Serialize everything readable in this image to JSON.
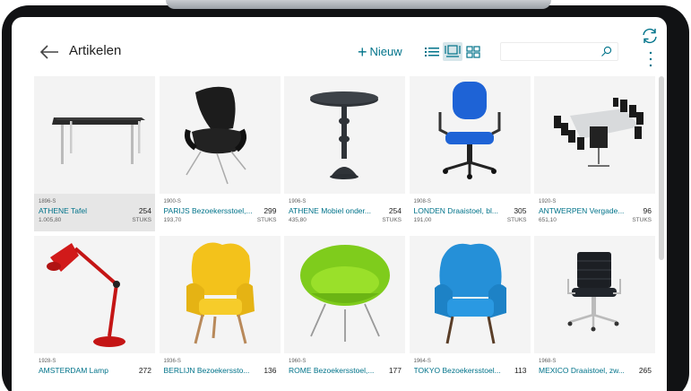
{
  "header": {
    "title": "Artikelen",
    "new_label": "Nieuw"
  },
  "items": [
    {
      "code": "1896-S",
      "name": "ATHENE Tafel",
      "qty": "254",
      "price": "1.005,80",
      "unit": "STUKS",
      "selected": true
    },
    {
      "code": "1900-S",
      "name": "PARIJS Bezoekersstoel,...",
      "qty": "299",
      "price": "193,70",
      "unit": "STUKS"
    },
    {
      "code": "1906-S",
      "name": "ATHENE Mobiel onder...",
      "qty": "254",
      "price": "435,80",
      "unit": "STUKS"
    },
    {
      "code": "1908-S",
      "name": "LONDEN Draaistoel, bl...",
      "qty": "305",
      "price": "191,00",
      "unit": "STUKS"
    },
    {
      "code": "1920-S",
      "name": "ANTWERPEN Vergade...",
      "qty": "96",
      "price": "651,10",
      "unit": "STUKS"
    },
    {
      "code": "1928-S",
      "name": "AMSTERDAM Lamp",
      "qty": "272",
      "price": "",
      "unit": ""
    },
    {
      "code": "1936-S",
      "name": "BERLIJN Bezoekerssto...",
      "qty": "136",
      "price": "",
      "unit": ""
    },
    {
      "code": "1960-S",
      "name": "ROME Bezoekersstoel,...",
      "qty": "177",
      "price": "",
      "unit": ""
    },
    {
      "code": "1964-S",
      "name": "TOKYO Bezoekersstoel...",
      "qty": "113",
      "price": "",
      "unit": ""
    },
    {
      "code": "1968-S",
      "name": "MEXICO Draaistoel, zw...",
      "qty": "265",
      "price": "",
      "unit": ""
    }
  ],
  "colors": {
    "accent": "#00738a",
    "selected_bg": "#e6e6e6"
  },
  "icons": [
    "back-arrow-icon",
    "plus-icon",
    "list-view-icon",
    "tile-view-icon",
    "grid-view-icon",
    "search-icon",
    "refresh-icon",
    "more-vertical-icon"
  ]
}
